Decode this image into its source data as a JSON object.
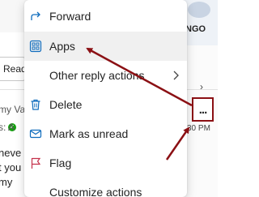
{
  "background": {
    "top_right_text": "NGO",
    "read_button_label": "Read",
    "sender_line": "my Va",
    "status_line": "s:  A",
    "time_text": "30 PM",
    "body_lines": [
      "neve",
      "t you",
      "my"
    ]
  },
  "more_button": {
    "label": "...",
    "icon": "more-horizontal-icon"
  },
  "menu": {
    "items": [
      {
        "label": "Forward",
        "icon": "forward-arrow-icon"
      },
      {
        "label": "Apps",
        "icon": "apps-grid-icon"
      },
      {
        "label": "Other reply actions",
        "icon": "",
        "has_submenu": true
      },
      {
        "label": "Delete",
        "icon": "trash-icon"
      },
      {
        "label": "Mark as unread",
        "icon": "envelope-icon"
      },
      {
        "label": "Flag",
        "icon": "flag-icon"
      },
      {
        "label": "Customize actions",
        "icon": ""
      }
    ],
    "highlighted_item": "Apps"
  },
  "colors": {
    "accent_blue": "#0f6cbd",
    "annotation_red": "#8b1014",
    "flag_red": "#c4314b",
    "hover_bg": "#f0f0f0"
  }
}
